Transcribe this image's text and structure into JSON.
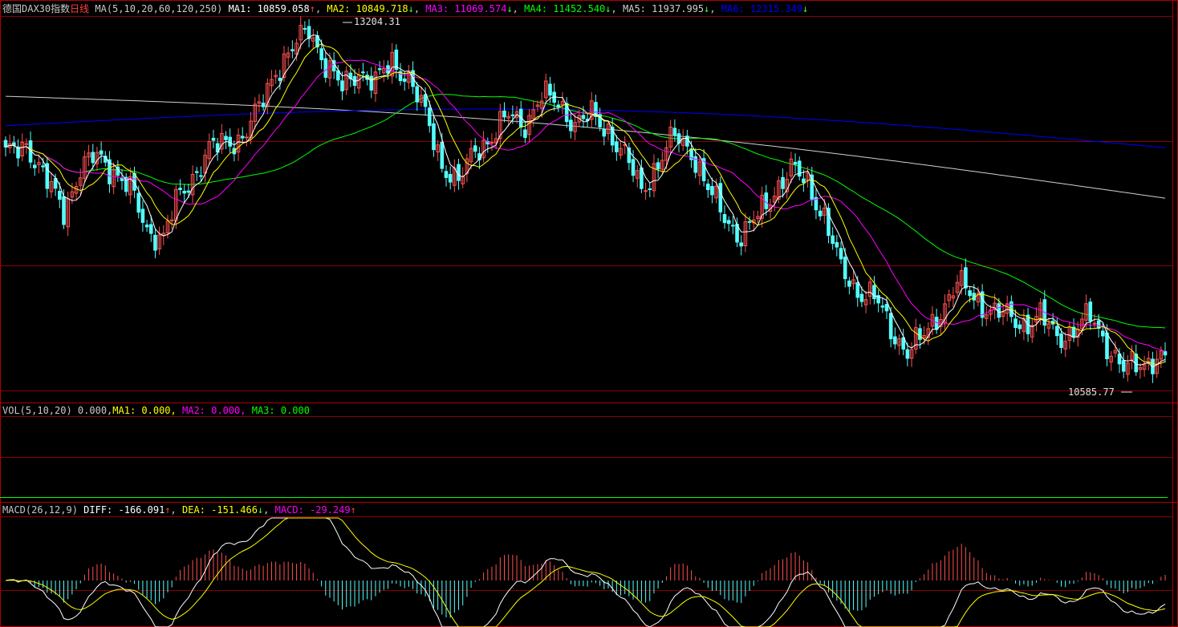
{
  "colors": {
    "up": "#ff5050",
    "down": "#54ffff",
    "grid": "#8b0000",
    "border": "#b00000",
    "ma1": "#ffffff",
    "ma2": "#ffff00",
    "ma3": "#ff00ff",
    "ma4": "#00ff00",
    "ma5": "#d0d0d0",
    "ma6": "#0000ff",
    "diff": "#ffffff",
    "dea": "#ffff00",
    "macd_pos": "#ff5050",
    "macd_neg": "#54ffff",
    "vol_ma3": "#00ff00"
  },
  "main_legend": {
    "instrument": "德国DAX30指数",
    "period": "日线",
    "ma_params": "MA(5,10,20,60,120,250)",
    "ma1_label": "MA1: 10859.058",
    "ma1_arrow": "↑",
    "ma2_label": "MA2: 10849.718",
    "ma2_arrow": "↓",
    "ma3_label": "MA3: 11069.574",
    "ma3_arrow": "↓",
    "ma4_label": "MA4: 11452.540",
    "ma4_arrow": "↓",
    "ma5_label": "MA5: 11937.995",
    "ma5_arrow": "↓",
    "ma6_label": "MA6: 12315.349",
    "ma6_arrow": "↓"
  },
  "vol_legend": {
    "params": "VOL(5,10,20) 0.000,",
    "ma1": "MA1: 0.000,",
    "ma2": "MA2: 0.000,",
    "ma3": "MA3: 0.000"
  },
  "macd_legend": {
    "params": "MACD(26,12,9)",
    "diff": "DIFF: -166.091",
    "diff_arrow": "↑",
    "dea": "DEA: -151.466",
    "dea_arrow": "↓",
    "macd": "MACD: -29.249",
    "macd_arrow": "↑"
  },
  "chart_data": [
    {
      "type": "candlestick",
      "annotations": {
        "high_label": "13204.31",
        "low_label": "10585.77"
      },
      "y_range": [
        10500,
        13300
      ],
      "ma_start_values": {
        "ma5": 12700,
        "ma6": 12480
      },
      "ma_end_values": {
        "ma1": 10859.058,
        "ma2": 10849.718,
        "ma3": 11069.574,
        "ma4": 11452.54,
        "ma5": 11937.995,
        "ma6": 12315.349
      }
    },
    {
      "type": "bar",
      "name": "VOL",
      "values_all": 0.0
    },
    {
      "type": "bar",
      "name": "MACD",
      "diff_last": -166.091,
      "dea_last": -151.466,
      "macd_last": -29.249
    }
  ]
}
